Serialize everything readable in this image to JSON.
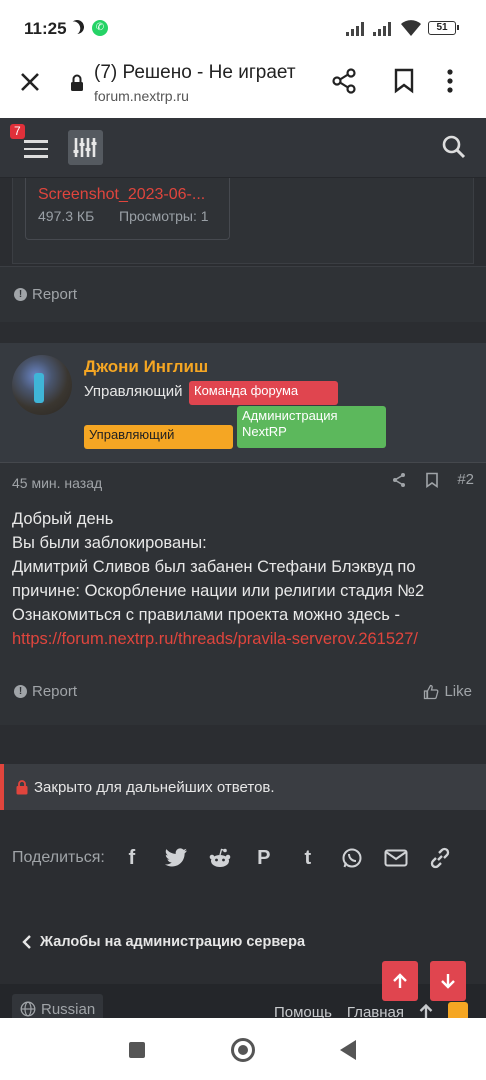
{
  "status_bar": {
    "time": "11:25",
    "battery": "51"
  },
  "browser": {
    "title": "(7) Решено - Не играет",
    "url": "forum.nextrp.ru"
  },
  "forum_header": {
    "notification_count": "7"
  },
  "attachment": {
    "filename": "Screenshot_2023-06-...",
    "size": "497.3 КБ",
    "views": "Просмотры: 1"
  },
  "post1": {
    "report_label": "Report"
  },
  "post2": {
    "author": "Джони Инглиш",
    "user_title": "Управляющий",
    "banners": {
      "team": "Команда форума",
      "role": "Управляющий",
      "admin": "Администрация NextRP"
    },
    "time": "45 мин. назад",
    "number": "#2",
    "body": {
      "line1": "Добрый день",
      "line2": "Вы были заблокированы:",
      "line3": "Димитрий Сливов был забанен Стефани Блэквуд по причине: Оскорбление нации или религии стадия №2",
      "line4": "Ознакомиться с правилами проекта можно здесь -",
      "link": "https://forum.nextrp.ru/threads/pravila-serverov.261527/"
    },
    "report_label": "Report",
    "like_label": "Like"
  },
  "closed_notice": "Закрыто для дальнейших ответов.",
  "share": {
    "label": "Поделиться:",
    "icons": [
      "facebook-icon",
      "twitter-icon",
      "reddit-icon",
      "pinterest-icon",
      "tumblr-icon",
      "whatsapp-icon",
      "email-icon",
      "link-icon"
    ]
  },
  "breadcrumb": "Жалобы на администрацию сервера",
  "footer": {
    "language": "Russian",
    "links": [
      "Помощь",
      "Главная"
    ]
  },
  "colors": {
    "accent": "#e0454f",
    "username": "#f5a623",
    "link": "#e0453d",
    "green_banner": "#5cb85c"
  }
}
